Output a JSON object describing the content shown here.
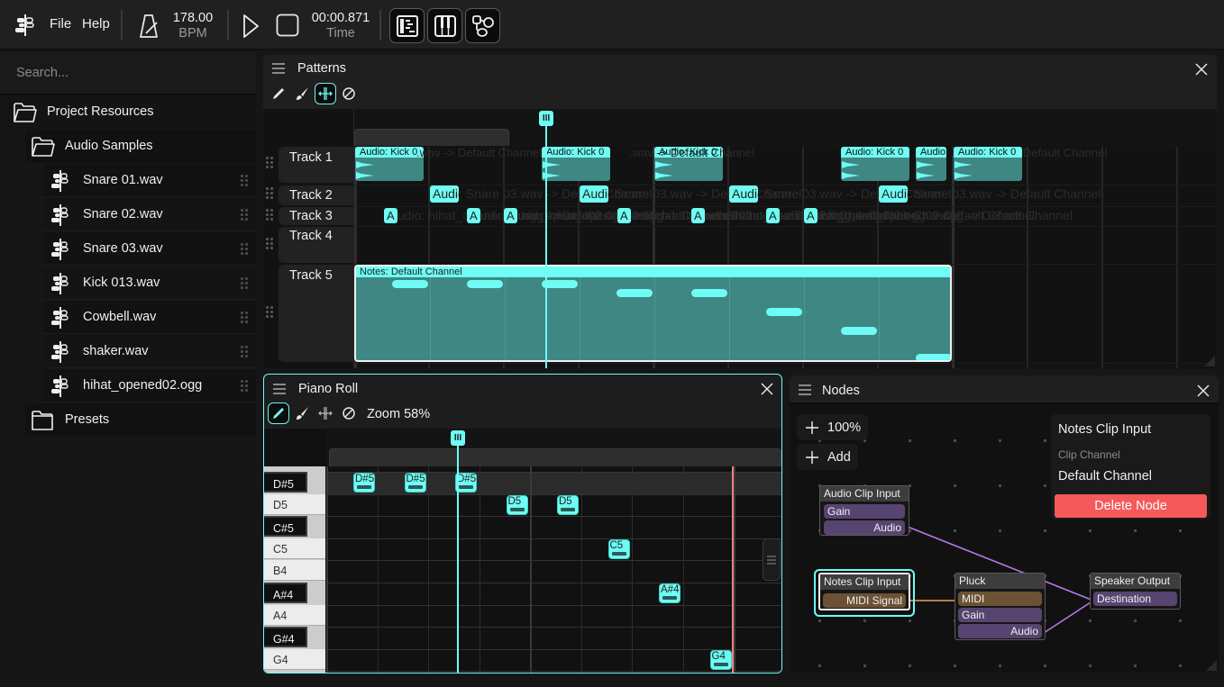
{
  "topbar": {
    "menu": [
      "File",
      "Help"
    ],
    "bpm_value": "178.00",
    "bpm_label": "BPM",
    "time_value": "00:00.871",
    "time_label": "Time",
    "icons": [
      "app-logo-icon",
      "metronome-icon",
      "play-icon",
      "stop-icon",
      "patterns-view-icon",
      "piano-view-icon",
      "nodes-view-icon"
    ]
  },
  "sidebar": {
    "search_placeholder": "Search...",
    "root": "Project Resources",
    "folder": "Audio Samples",
    "files": [
      "Snare 01.wav",
      "Snare 02.wav",
      "Snare 03.wav",
      "Kick 013.wav",
      "Cowbell.wav",
      "shaker.wav",
      "hihat_opened02.ogg"
    ],
    "presets": "Presets"
  },
  "patterns": {
    "title": "Patterns",
    "tools": [
      "pencil",
      "brush",
      "resize",
      "erase"
    ],
    "active_tool": "resize",
    "tracks": [
      "Track 1",
      "Track 2",
      "Track 3",
      "Track 4",
      "Track 5"
    ],
    "track1_clip_label": "Audio: Kick 013.wav -> Default Channel",
    "track1_clip_short": "Audio: Kick 0",
    "track2_clip_label": "Audio: Snare 03.wav -> Default Channel",
    "track2_clip_short": "Audio",
    "track3_clip_label": "Audio: hihat_opened02.ogg -> Default Channel",
    "track3_clip_short": "A",
    "track5_clip_label": "Notes: Default Channel",
    "playhead_icon": "III"
  },
  "pianoroll": {
    "title": "Piano Roll",
    "zoom_label": "Zoom 58%",
    "keys": [
      {
        "name": "D#5",
        "black": true
      },
      {
        "name": "D5",
        "black": false
      },
      {
        "name": "C#5",
        "black": true
      },
      {
        "name": "C5",
        "black": false
      },
      {
        "name": "B4",
        "black": false
      },
      {
        "name": "A#4",
        "black": true
      },
      {
        "name": "A4",
        "black": false
      },
      {
        "name": "G#4",
        "black": true
      },
      {
        "name": "G4",
        "black": false
      }
    ],
    "notes": [
      {
        "pitch": "D#5",
        "beat": 0
      },
      {
        "pitch": "D#5",
        "beat": 1
      },
      {
        "pitch": "D#5",
        "beat": 2
      },
      {
        "pitch": "D5",
        "beat": 3
      },
      {
        "pitch": "D5",
        "beat": 4
      },
      {
        "pitch": "C5",
        "beat": 5
      },
      {
        "pitch": "A#4",
        "beat": 6
      },
      {
        "pitch": "G4",
        "beat": 7
      }
    ],
    "playhead_icon": "III"
  },
  "nodes": {
    "title": "Nodes",
    "zoom_label": "100%",
    "add_label": "Add",
    "inspector": {
      "title": "Notes Clip Input",
      "field_label": "Clip Channel",
      "field_value": "Default Channel",
      "delete_label": "Delete Node"
    },
    "graph": {
      "audio_clip_input": {
        "title": "Audio Clip Input",
        "ports": [
          "Gain",
          "Audio"
        ]
      },
      "notes_clip_input": {
        "title": "Notes Clip Input",
        "ports": [
          "MIDI Signal"
        ]
      },
      "pluck": {
        "title": "Pluck",
        "ports": [
          "MIDI",
          "Gain",
          "Audio"
        ]
      },
      "speaker_output": {
        "title": "Speaker Output",
        "ports": [
          "Destination"
        ]
      }
    }
  },
  "colors": {
    "accent": "#6efcf4",
    "clip": "#3f8783",
    "delete": "#f55a5a",
    "audio_wire": "#b577f0",
    "midi_wire": "#f0a050",
    "playhead_end": "#f08080"
  }
}
